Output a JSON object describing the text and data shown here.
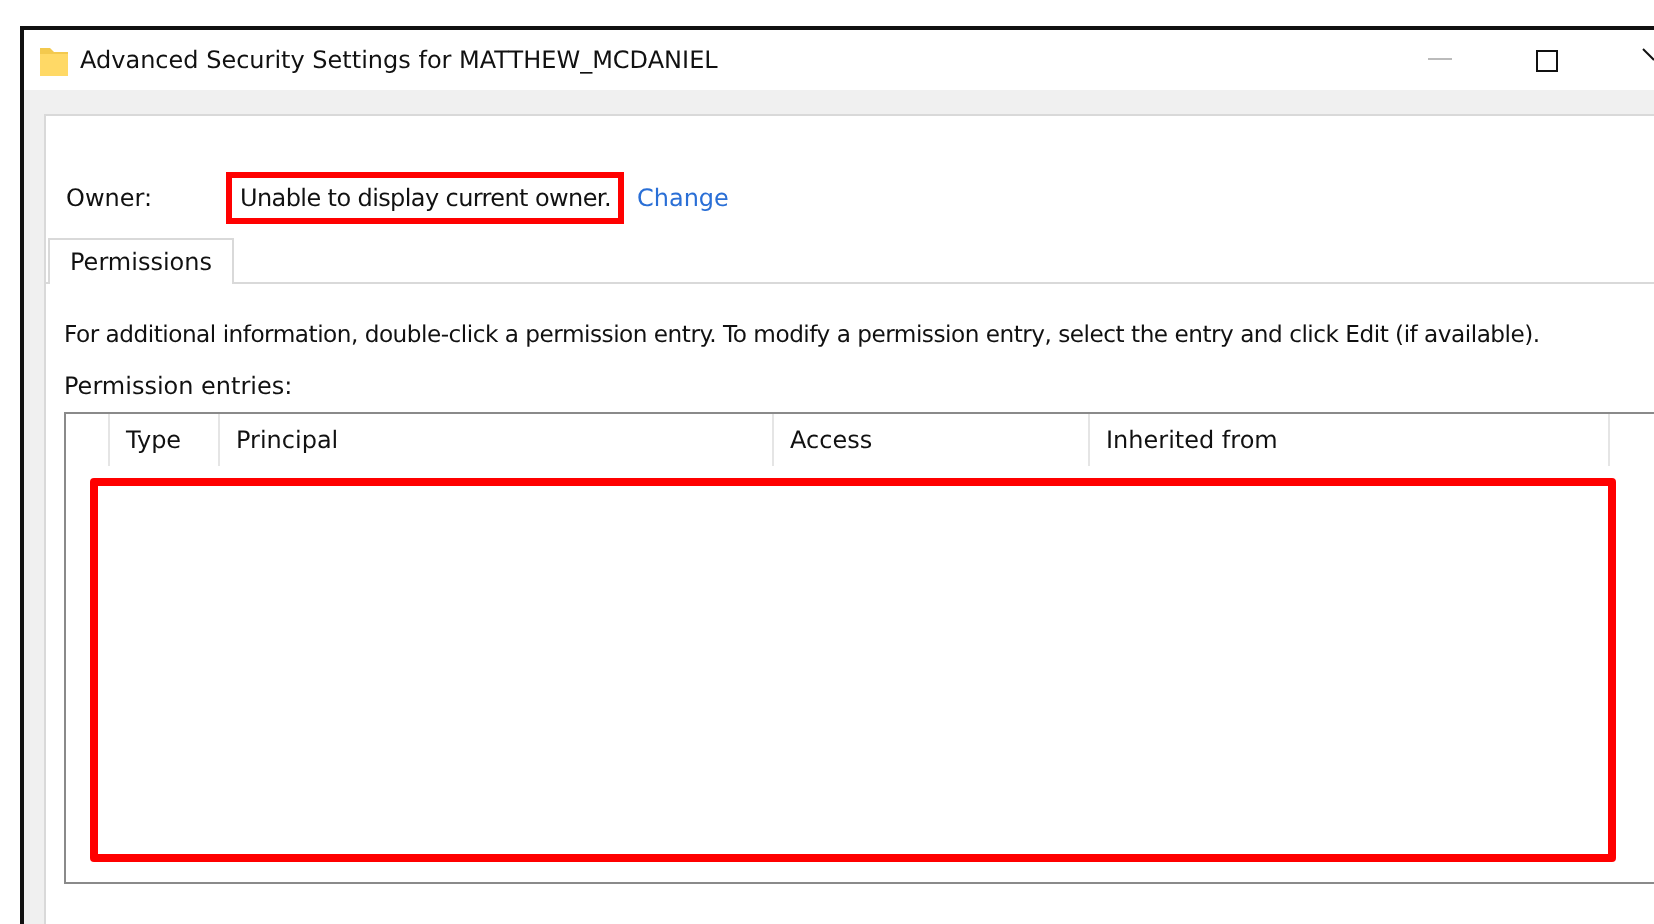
{
  "window": {
    "title": "Advanced Security Settings for MATTHEW_MCDANIEL"
  },
  "owner": {
    "label": "Owner:",
    "value": "Unable to display current owner.",
    "highlighted": true,
    "link": "Change"
  },
  "tabs": [
    {
      "label": "Permissions",
      "selected": true
    }
  ],
  "info_text": "For additional information, double-click a permission entry. To modify a permission entry, select the entry and click Edit (if available).",
  "entries_label": "Permission entries:",
  "table": {
    "columns": [
      "Type",
      "Principal",
      "Access",
      "Inherited from"
    ],
    "highlighted": true
  }
}
